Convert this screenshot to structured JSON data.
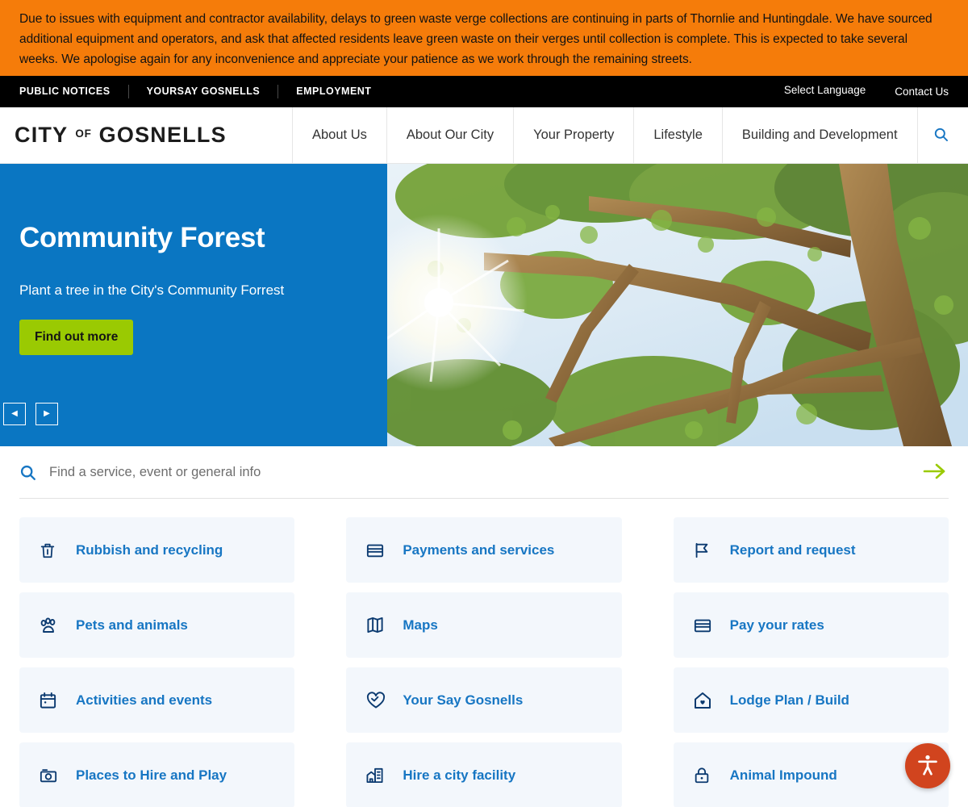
{
  "alert": {
    "text": "Due to issues with equipment and contractor availability, delays to green waste verge collections are continuing in parts of Thornlie and Huntingdale. We have sourced additional equipment and operators, and ask that affected residents leave green waste on their verges until collection is complete. This is expected to take several weeks. We apologise again for any inconvenience and appreciate your patience as we work through the remaining streets.",
    "background": "#F57C0A"
  },
  "utility_bar": {
    "left_links": [
      {
        "label": "PUBLIC NOTICES"
      },
      {
        "label": "YOURSAY GOSNELLS"
      },
      {
        "label": "EMPLOYMENT"
      }
    ],
    "right_links": [
      {
        "label": "Select Language"
      },
      {
        "label": "Contact Us"
      }
    ],
    "background": "#000000"
  },
  "header": {
    "logo": {
      "city": "CITY",
      "of": "OF",
      "gosnells": "GOSNELLS"
    },
    "nav": [
      {
        "label": "About Us"
      },
      {
        "label": "About Our City"
      },
      {
        "label": "Your Property"
      },
      {
        "label": "Lifestyle"
      },
      {
        "label": "Building and Development"
      }
    ],
    "search_toggle_icon": "search-icon"
  },
  "hero": {
    "title": "Community Forest",
    "subtitle": "Plant a tree in the City's Community Forrest",
    "button_label": "Find out more",
    "prev_label": "◀",
    "next_label": "▶",
    "panel_color": "#0a76c2",
    "button_color": "#9ACA02"
  },
  "site_search": {
    "placeholder": "Find a service, event or general info",
    "value": "",
    "icon": "search-icon",
    "submit_icon": "arrow-right-icon",
    "submit_color": "#9ACA02"
  },
  "quicklinks": {
    "tiles": [
      {
        "label": "Rubbish and recycling",
        "icon": "trash-icon"
      },
      {
        "label": "Payments and services",
        "icon": "credit-card-icon"
      },
      {
        "label": "Report and request",
        "icon": "flag-icon"
      },
      {
        "label": "Pets and animals",
        "icon": "paw-icon"
      },
      {
        "label": "Maps",
        "icon": "map-icon"
      },
      {
        "label": "Pay your rates",
        "icon": "credit-card-icon"
      },
      {
        "label": "Activities and events",
        "icon": "calendar-icon"
      },
      {
        "label": "Your Say Gosnells",
        "icon": "heart-chat-icon"
      },
      {
        "label": "Lodge Plan / Build",
        "icon": "home-heart-icon"
      },
      {
        "label": "Places to Hire and Play",
        "icon": "camera-icon"
      },
      {
        "label": "Hire a city facility",
        "icon": "building-icon"
      },
      {
        "label": "Animal Impound",
        "icon": "lock-icon"
      }
    ],
    "tile_background": "#f3f7fc",
    "label_color": "#1776c3",
    "icon_color": "#0b3a70"
  },
  "accessibility": {
    "label": "Accessibility options",
    "icon": "accessibility-person-icon",
    "color": "#D1441E"
  }
}
